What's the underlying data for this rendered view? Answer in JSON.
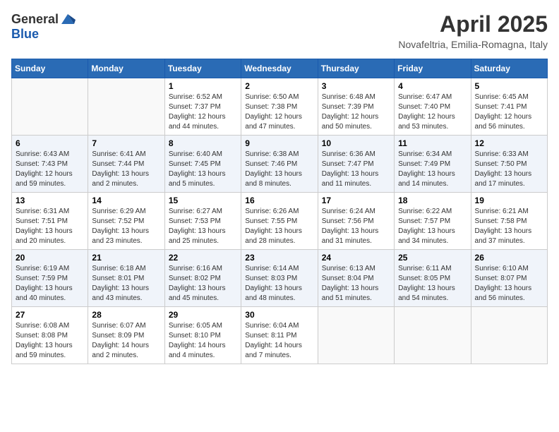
{
  "header": {
    "logo_general": "General",
    "logo_blue": "Blue",
    "title": "April 2025",
    "subtitle": "Novafeltria, Emilia-Romagna, Italy"
  },
  "days_of_week": [
    "Sunday",
    "Monday",
    "Tuesday",
    "Wednesday",
    "Thursday",
    "Friday",
    "Saturday"
  ],
  "weeks": [
    [
      {
        "day": "",
        "info": ""
      },
      {
        "day": "",
        "info": ""
      },
      {
        "day": "1",
        "info": "Sunrise: 6:52 AM\nSunset: 7:37 PM\nDaylight: 12 hours\nand 44 minutes."
      },
      {
        "day": "2",
        "info": "Sunrise: 6:50 AM\nSunset: 7:38 PM\nDaylight: 12 hours\nand 47 minutes."
      },
      {
        "day": "3",
        "info": "Sunrise: 6:48 AM\nSunset: 7:39 PM\nDaylight: 12 hours\nand 50 minutes."
      },
      {
        "day": "4",
        "info": "Sunrise: 6:47 AM\nSunset: 7:40 PM\nDaylight: 12 hours\nand 53 minutes."
      },
      {
        "day": "5",
        "info": "Sunrise: 6:45 AM\nSunset: 7:41 PM\nDaylight: 12 hours\nand 56 minutes."
      }
    ],
    [
      {
        "day": "6",
        "info": "Sunrise: 6:43 AM\nSunset: 7:43 PM\nDaylight: 12 hours\nand 59 minutes."
      },
      {
        "day": "7",
        "info": "Sunrise: 6:41 AM\nSunset: 7:44 PM\nDaylight: 13 hours\nand 2 minutes."
      },
      {
        "day": "8",
        "info": "Sunrise: 6:40 AM\nSunset: 7:45 PM\nDaylight: 13 hours\nand 5 minutes."
      },
      {
        "day": "9",
        "info": "Sunrise: 6:38 AM\nSunset: 7:46 PM\nDaylight: 13 hours\nand 8 minutes."
      },
      {
        "day": "10",
        "info": "Sunrise: 6:36 AM\nSunset: 7:47 PM\nDaylight: 13 hours\nand 11 minutes."
      },
      {
        "day": "11",
        "info": "Sunrise: 6:34 AM\nSunset: 7:49 PM\nDaylight: 13 hours\nand 14 minutes."
      },
      {
        "day": "12",
        "info": "Sunrise: 6:33 AM\nSunset: 7:50 PM\nDaylight: 13 hours\nand 17 minutes."
      }
    ],
    [
      {
        "day": "13",
        "info": "Sunrise: 6:31 AM\nSunset: 7:51 PM\nDaylight: 13 hours\nand 20 minutes."
      },
      {
        "day": "14",
        "info": "Sunrise: 6:29 AM\nSunset: 7:52 PM\nDaylight: 13 hours\nand 23 minutes."
      },
      {
        "day": "15",
        "info": "Sunrise: 6:27 AM\nSunset: 7:53 PM\nDaylight: 13 hours\nand 25 minutes."
      },
      {
        "day": "16",
        "info": "Sunrise: 6:26 AM\nSunset: 7:55 PM\nDaylight: 13 hours\nand 28 minutes."
      },
      {
        "day": "17",
        "info": "Sunrise: 6:24 AM\nSunset: 7:56 PM\nDaylight: 13 hours\nand 31 minutes."
      },
      {
        "day": "18",
        "info": "Sunrise: 6:22 AM\nSunset: 7:57 PM\nDaylight: 13 hours\nand 34 minutes."
      },
      {
        "day": "19",
        "info": "Sunrise: 6:21 AM\nSunset: 7:58 PM\nDaylight: 13 hours\nand 37 minutes."
      }
    ],
    [
      {
        "day": "20",
        "info": "Sunrise: 6:19 AM\nSunset: 7:59 PM\nDaylight: 13 hours\nand 40 minutes."
      },
      {
        "day": "21",
        "info": "Sunrise: 6:18 AM\nSunset: 8:01 PM\nDaylight: 13 hours\nand 43 minutes."
      },
      {
        "day": "22",
        "info": "Sunrise: 6:16 AM\nSunset: 8:02 PM\nDaylight: 13 hours\nand 45 minutes."
      },
      {
        "day": "23",
        "info": "Sunrise: 6:14 AM\nSunset: 8:03 PM\nDaylight: 13 hours\nand 48 minutes."
      },
      {
        "day": "24",
        "info": "Sunrise: 6:13 AM\nSunset: 8:04 PM\nDaylight: 13 hours\nand 51 minutes."
      },
      {
        "day": "25",
        "info": "Sunrise: 6:11 AM\nSunset: 8:05 PM\nDaylight: 13 hours\nand 54 minutes."
      },
      {
        "day": "26",
        "info": "Sunrise: 6:10 AM\nSunset: 8:07 PM\nDaylight: 13 hours\nand 56 minutes."
      }
    ],
    [
      {
        "day": "27",
        "info": "Sunrise: 6:08 AM\nSunset: 8:08 PM\nDaylight: 13 hours\nand 59 minutes."
      },
      {
        "day": "28",
        "info": "Sunrise: 6:07 AM\nSunset: 8:09 PM\nDaylight: 14 hours\nand 2 minutes."
      },
      {
        "day": "29",
        "info": "Sunrise: 6:05 AM\nSunset: 8:10 PM\nDaylight: 14 hours\nand 4 minutes."
      },
      {
        "day": "30",
        "info": "Sunrise: 6:04 AM\nSunset: 8:11 PM\nDaylight: 14 hours\nand 7 minutes."
      },
      {
        "day": "",
        "info": ""
      },
      {
        "day": "",
        "info": ""
      },
      {
        "day": "",
        "info": ""
      }
    ]
  ]
}
